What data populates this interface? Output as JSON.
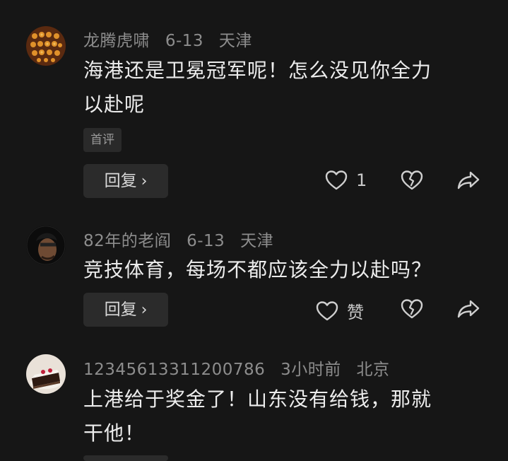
{
  "comments": [
    {
      "username": "龙腾虎啸",
      "date": "6-13",
      "location": "天津",
      "text_line1": "海港还是卫冕冠军呢！怎么没见你全力",
      "text_line2": "以赴呢",
      "badge": "首评",
      "reply_label": "回复",
      "like_count": "1"
    },
    {
      "username": "82年的老阎",
      "date": "6-13",
      "location": "天津",
      "text_line1": "竞技体育，每场不都应该全力以赴吗？",
      "reply_label": "回复",
      "like_label": "赞"
    },
    {
      "username": "12345613311200786",
      "date": "3小时前",
      "location": "北京",
      "text_line1": "上港给于奖金了！山东没有给钱，那就",
      "text_line2": "干他！"
    }
  ],
  "icons": {
    "heart": "heart-outline-icon",
    "broken_heart": "broken-heart-icon",
    "share": "share-arrow-icon",
    "chevron": "chevron-right-icon"
  },
  "colors": {
    "background": "#161616",
    "meta_text": "#8d8d8d",
    "body_text": "#ececec",
    "button_bg": "#2b2b2b"
  }
}
